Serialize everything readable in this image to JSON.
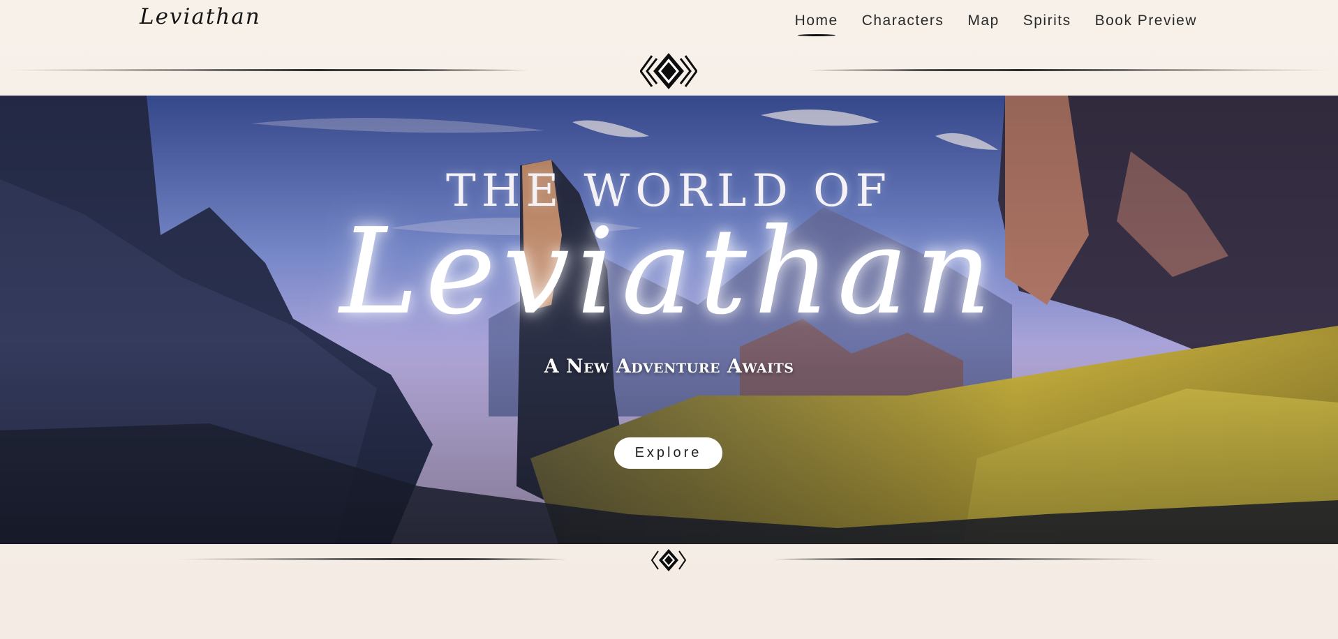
{
  "header": {
    "logo": "Leviathan",
    "nav": [
      {
        "label": "Home",
        "active": true
      },
      {
        "label": "Characters",
        "active": false
      },
      {
        "label": "Map",
        "active": false
      },
      {
        "label": "Spirits",
        "active": false
      },
      {
        "label": "Book Preview",
        "active": false
      }
    ]
  },
  "hero": {
    "pretitle": "THE WORLD OF",
    "title": "Leviathan",
    "tagline": "A New Adventure Awaits",
    "button_label": "Explore"
  },
  "icons": {
    "top_ornament": "diamond-ornament-icon",
    "bottom_ornament": "diamond-ornament-icon"
  },
  "colors": {
    "background": "#f6efe8",
    "ink": "#1a1a1a",
    "sky": "#6f7fc6",
    "meadow": "#c9b23e"
  }
}
